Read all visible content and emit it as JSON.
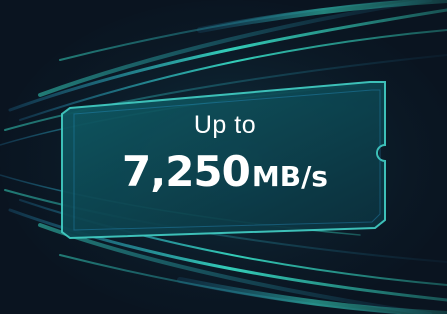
{
  "headline": {
    "prefix": "Up to",
    "value": "7,250",
    "unit": "MB/s"
  },
  "colors": {
    "background": "#0a1420",
    "card_fill_start": "#0f5a64",
    "card_fill_end": "#0b2f3c",
    "card_edge": "#40c9c0",
    "streak_primary": "#38e0c8",
    "streak_secondary": "#2a9fd6",
    "text": "#ffffff"
  }
}
